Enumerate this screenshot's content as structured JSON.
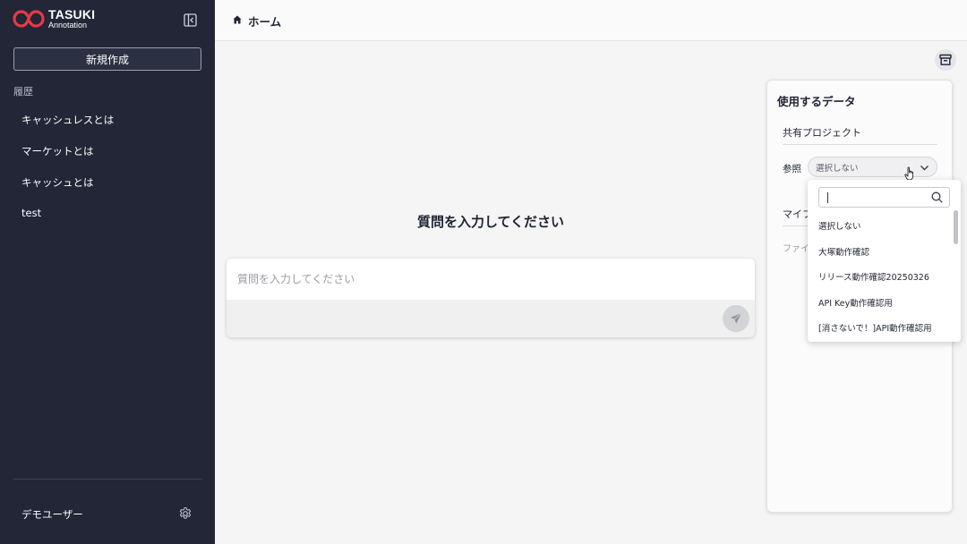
{
  "app": {
    "logo_name": "TASUKI",
    "logo_sub": "Annotation",
    "brand_color": "#e63a46"
  },
  "sidebar": {
    "new_button": "新規作成",
    "history_label": "履歴",
    "history": [
      {
        "label": "キャッシュレスとは"
      },
      {
        "label": "マーケットとは"
      },
      {
        "label": "キャッシュとは"
      },
      {
        "label": "test"
      }
    ],
    "user_name": "デモユーザー"
  },
  "header": {
    "breadcrumb": "ホーム"
  },
  "main": {
    "heading": "質問を入力してください",
    "input_placeholder": "質問を入力してください",
    "input_value": ""
  },
  "data_panel": {
    "title": "使用するデータ",
    "shared_project_label": "共有プロジェクト",
    "reference_label": "参照",
    "reference_selected": "選択しない",
    "my_label": "マイフ",
    "file_label": "ファイ"
  },
  "dropdown": {
    "search_value": "",
    "options": [
      {
        "label": "選択しない"
      },
      {
        "label": "大塚動作確認"
      },
      {
        "label": "リリース動作確認20250326"
      },
      {
        "label": "API Key動作確認用"
      },
      {
        "label": "[消さないで！]API動作確認用"
      }
    ]
  },
  "icons": {
    "collapse": "sidebar-collapse-icon",
    "settings": "gear-icon",
    "home": "home-icon",
    "archive": "archive-icon",
    "send": "paper-plane-icon",
    "chevron": "chevron-down-icon",
    "search": "search-icon",
    "cursor": "hand-pointer-icon"
  }
}
